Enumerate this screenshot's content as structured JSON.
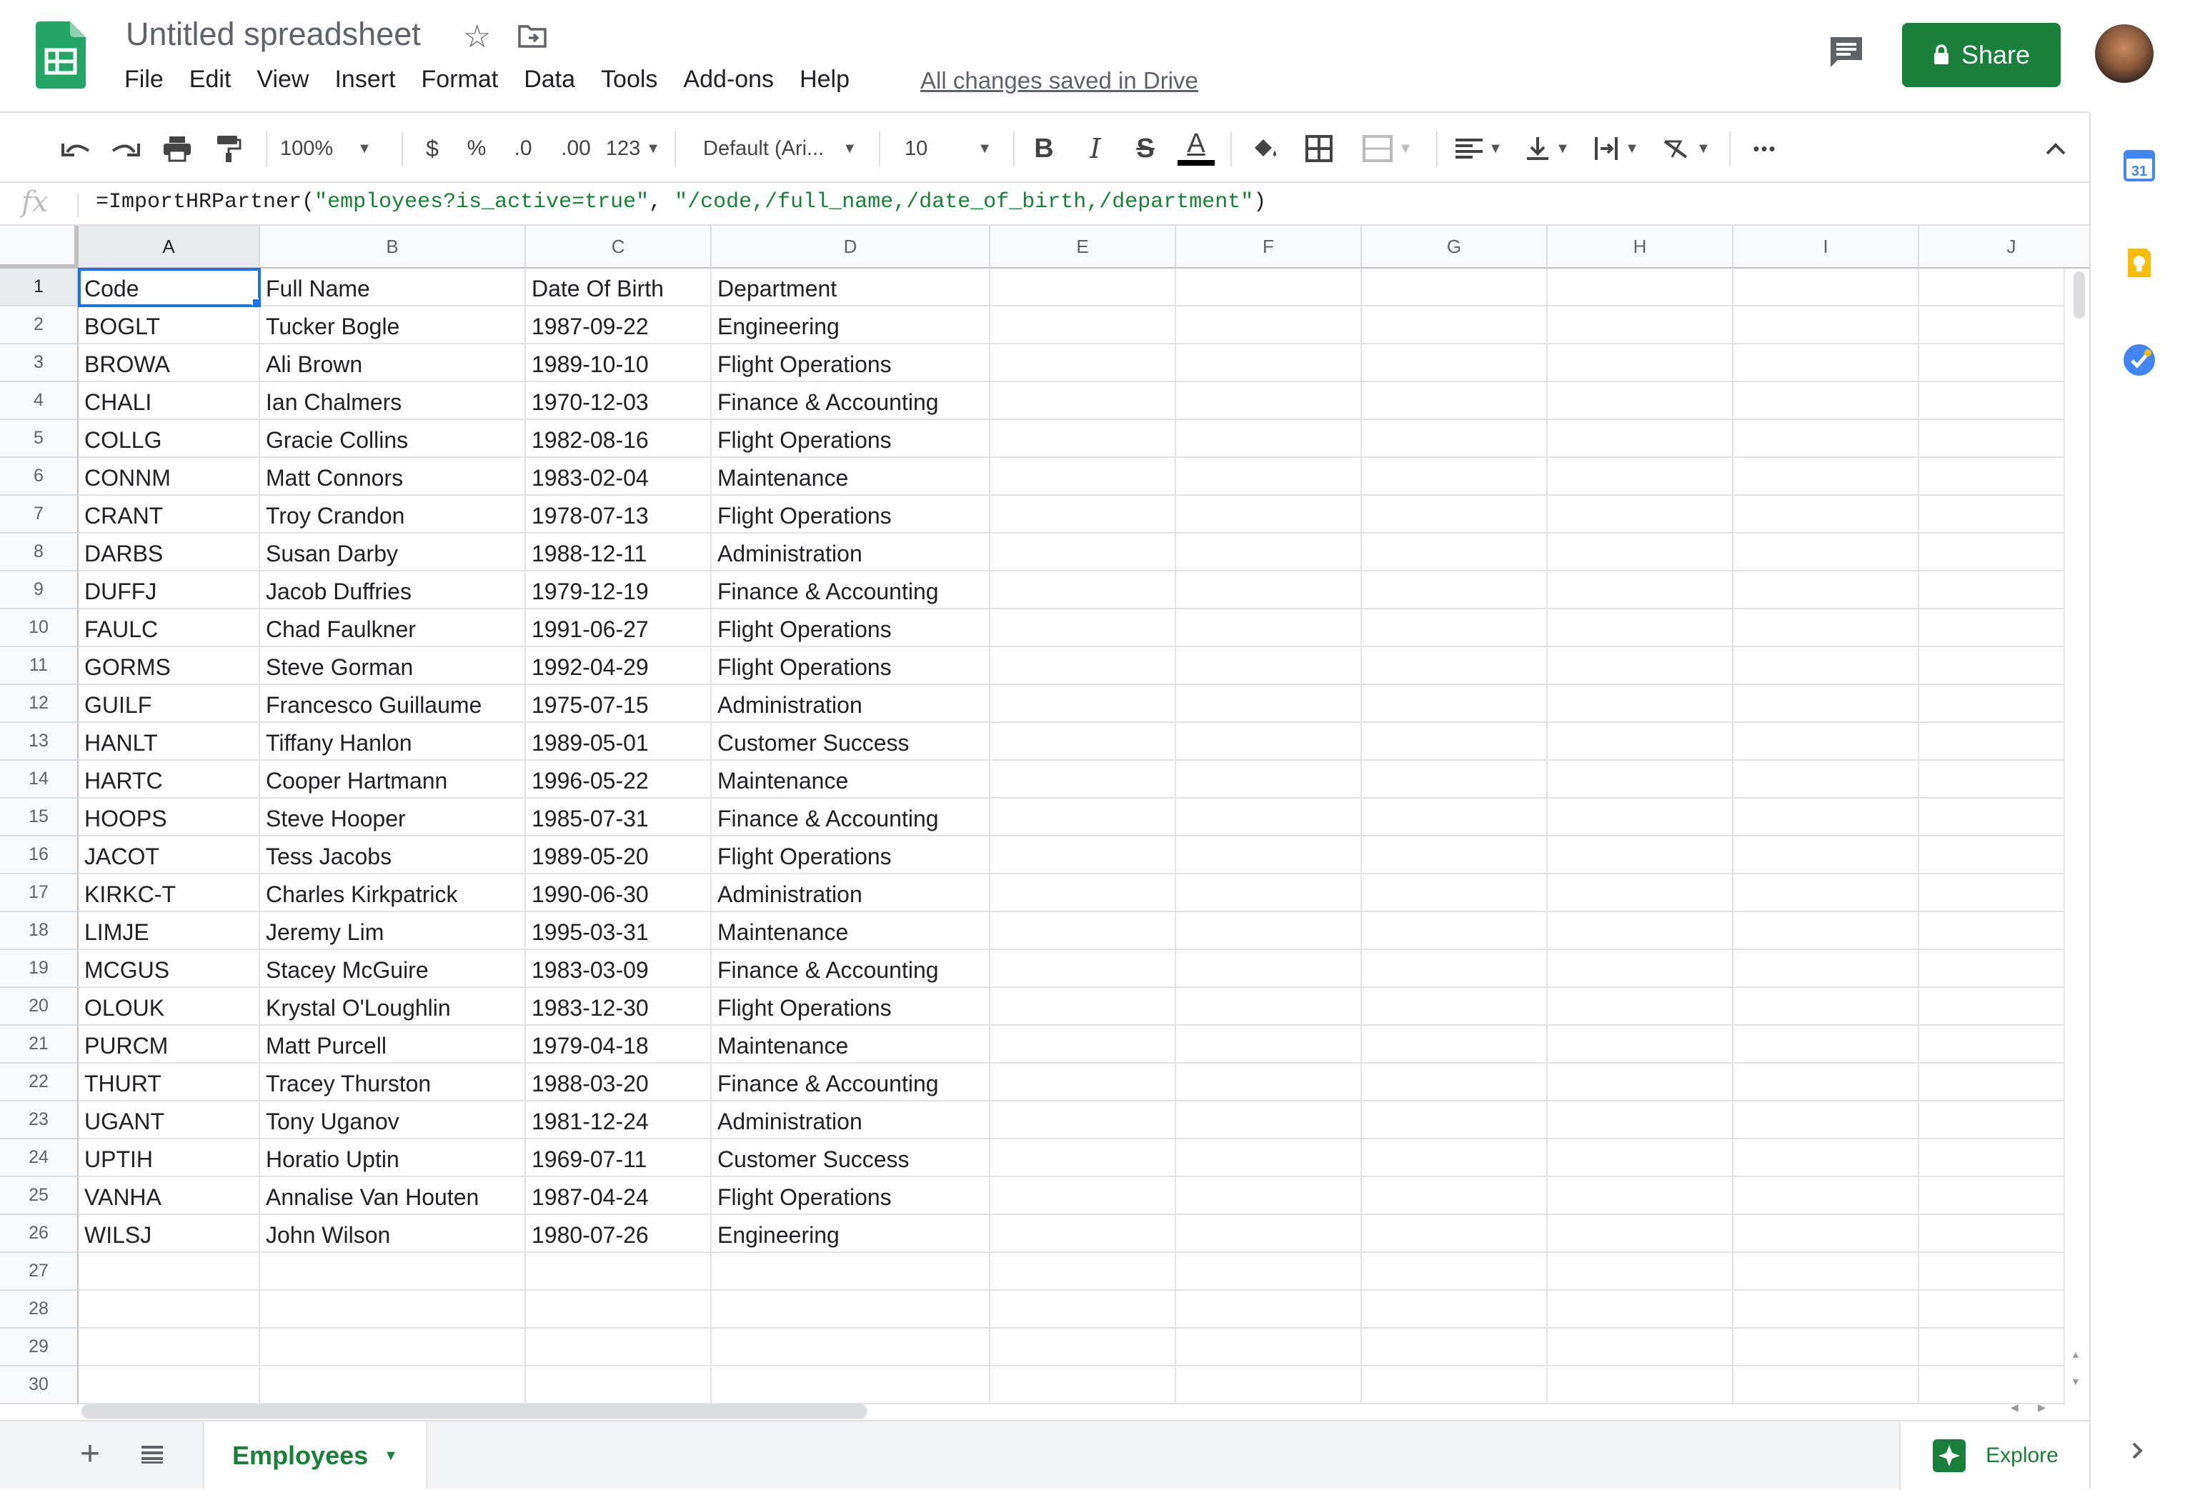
{
  "header": {
    "title": "Untitled spreadsheet",
    "menu": [
      "File",
      "Edit",
      "View",
      "Insert",
      "Format",
      "Data",
      "Tools",
      "Add-ons",
      "Help"
    ],
    "saved_status": "All changes saved in Drive",
    "share_label": "Share"
  },
  "toolbar": {
    "zoom": "100%",
    "currency": "$",
    "percent": "%",
    "decrease_decimal": ".0",
    "increase_decimal": ".00",
    "more_formats": "123",
    "font": "Default (Ari...",
    "font_size": "10",
    "bold": "B",
    "italic": "I",
    "strike": "S",
    "text_color": "A",
    "more": "•••"
  },
  "formula_bar": {
    "fx": "fx",
    "prefix": "=ImportHRPartner(",
    "arg1": "\"employees?is_active=true\"",
    "separator": ", ",
    "arg2": "\"/code,/full_name,/date_of_birth,/department\"",
    "suffix": ")"
  },
  "grid": {
    "columns": [
      "A",
      "B",
      "C",
      "D",
      "E",
      "F",
      "G",
      "H",
      "I",
      "J"
    ],
    "row_numbers": [
      "1",
      "2",
      "3",
      "4",
      "5",
      "6",
      "7",
      "8",
      "9",
      "10",
      "11",
      "12",
      "13",
      "14",
      "15",
      "16",
      "17",
      "18",
      "19",
      "20",
      "21",
      "22",
      "23",
      "24",
      "25",
      "26",
      "27",
      "28",
      "29",
      "30"
    ],
    "rows": [
      [
        "Code",
        "Full Name",
        "Date Of Birth",
        "Department"
      ],
      [
        "BOGLT",
        "Tucker Bogle",
        "1987-09-22",
        "Engineering"
      ],
      [
        "BROWA",
        "Ali Brown",
        "1989-10-10",
        "Flight Operations"
      ],
      [
        "CHALI",
        "Ian Chalmers",
        "1970-12-03",
        "Finance & Accounting"
      ],
      [
        "COLLG",
        "Gracie Collins",
        "1982-08-16",
        "Flight Operations"
      ],
      [
        "CONNM",
        "Matt Connors",
        "1983-02-04",
        "Maintenance"
      ],
      [
        "CRANT",
        "Troy Crandon",
        "1978-07-13",
        "Flight Operations"
      ],
      [
        "DARBS",
        "Susan Darby",
        "1988-12-11",
        "Administration"
      ],
      [
        "DUFFJ",
        "Jacob Duffries",
        "1979-12-19",
        "Finance & Accounting"
      ],
      [
        "FAULC",
        "Chad Faulkner",
        "1991-06-27",
        "Flight Operations"
      ],
      [
        "GORMS",
        "Steve Gorman",
        "1992-04-29",
        "Flight Operations"
      ],
      [
        "GUILF",
        "Francesco Guillaume",
        "1975-07-15",
        "Administration"
      ],
      [
        "HANLT",
        "Tiffany Hanlon",
        "1989-05-01",
        "Customer Success"
      ],
      [
        "HARTC",
        "Cooper Hartmann",
        "1996-05-22",
        "Maintenance"
      ],
      [
        "HOOPS",
        "Steve Hooper",
        "1985-07-31",
        "Finance & Accounting"
      ],
      [
        "JACOT",
        "Tess Jacobs",
        "1989-05-20",
        "Flight Operations"
      ],
      [
        "KIRKC-T",
        "Charles Kirkpatrick",
        "1990-06-30",
        "Administration"
      ],
      [
        "LIMJE",
        "Jeremy Lim",
        "1995-03-31",
        "Maintenance"
      ],
      [
        "MCGUS",
        "Stacey McGuire",
        "1983-03-09",
        "Finance & Accounting"
      ],
      [
        "OLOUK",
        "Krystal O'Loughlin",
        "1983-12-30",
        "Flight Operations"
      ],
      [
        "PURCM",
        "Matt Purcell",
        "1979-04-18",
        "Maintenance"
      ],
      [
        "THURT",
        "Tracey Thurston",
        "1988-03-20",
        "Finance & Accounting"
      ],
      [
        "UGANT",
        "Tony Uganov",
        "1981-12-24",
        "Administration"
      ],
      [
        "UPTIH",
        "Horatio Uptin",
        "1969-07-11",
        "Customer Success"
      ],
      [
        "VANHA",
        "Annalise Van Houten",
        "1987-04-24",
        "Flight Operations"
      ],
      [
        "WILSJ",
        "John Wilson",
        "1980-07-26",
        "Engineering"
      ]
    ]
  },
  "sheets": {
    "active": "Employees",
    "explore_label": "Explore"
  },
  "side_panel": {
    "calendar_day": "31"
  },
  "colors": {
    "brand_green": "#188038",
    "selection_blue": "#1a73e8"
  }
}
